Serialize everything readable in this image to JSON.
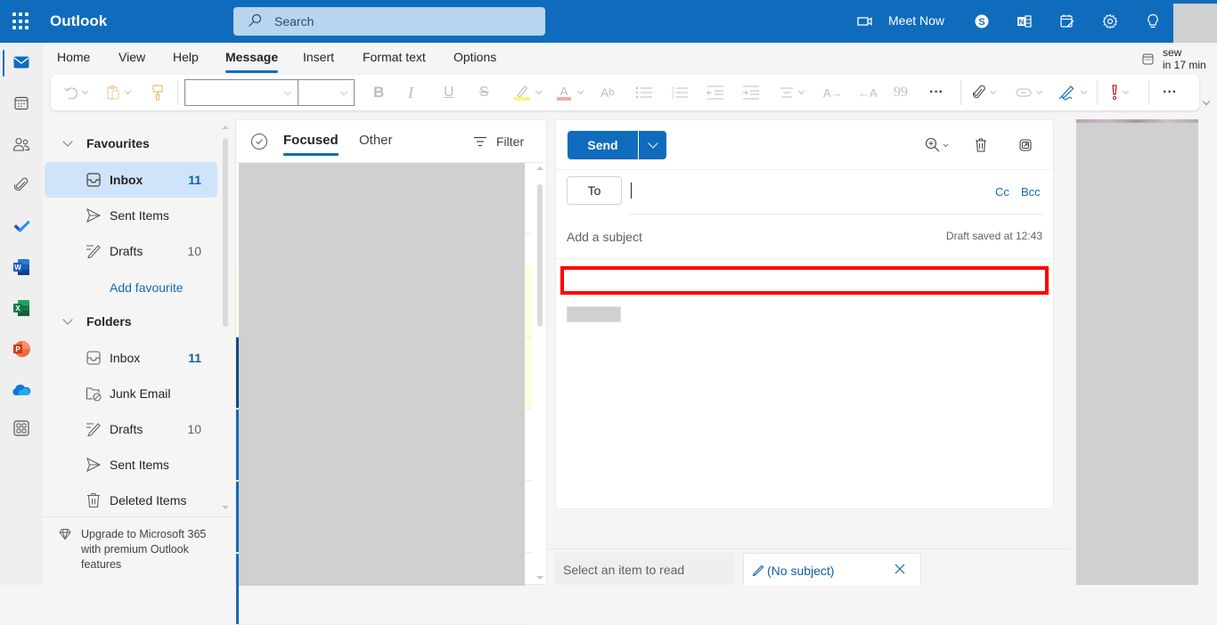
{
  "header": {
    "app_name": "Outlook",
    "search_placeholder": "Search",
    "meet_now": "Meet Now"
  },
  "reminder": {
    "title": "sew",
    "time": "in 17 min"
  },
  "menu": {
    "items": [
      "Home",
      "View",
      "Help",
      "Message",
      "Insert",
      "Format text",
      "Options"
    ],
    "active": "Message"
  },
  "ribbon": {
    "font_name": "",
    "font_size": ""
  },
  "nav": {
    "favourites_label": "Favourites",
    "favourites": [
      {
        "label": "Inbox",
        "count": "11"
      },
      {
        "label": "Sent Items",
        "count": ""
      },
      {
        "label": "Drafts",
        "count": "10"
      }
    ],
    "add_favourite": "Add favourite",
    "folders_label": "Folders",
    "folders": [
      {
        "label": "Inbox",
        "count": "11"
      },
      {
        "label": "Junk Email",
        "count": ""
      },
      {
        "label": "Drafts",
        "count": "10"
      },
      {
        "label": "Sent Items",
        "count": ""
      },
      {
        "label": "Deleted Items",
        "count": ""
      }
    ],
    "upgrade_text": "Upgrade to Microsoft 365 with premium Outlook features"
  },
  "message_list": {
    "tabs": [
      "Focused",
      "Other"
    ],
    "active_tab": "Focused",
    "filter_label": "Filter"
  },
  "compose": {
    "send_label": "Send",
    "to_label": "To",
    "to_value": "",
    "cc_label": "Cc",
    "bcc_label": "Bcc",
    "subject_placeholder": "Add a subject",
    "draft_status": "Draft saved at 12:43",
    "body": ""
  },
  "bottom_tabs": {
    "read_placeholder": "Select an item to read",
    "draft_tab": "(No subject)"
  },
  "colors": {
    "brand": "#0f6cbd",
    "highlight_box": "#ff0000"
  }
}
